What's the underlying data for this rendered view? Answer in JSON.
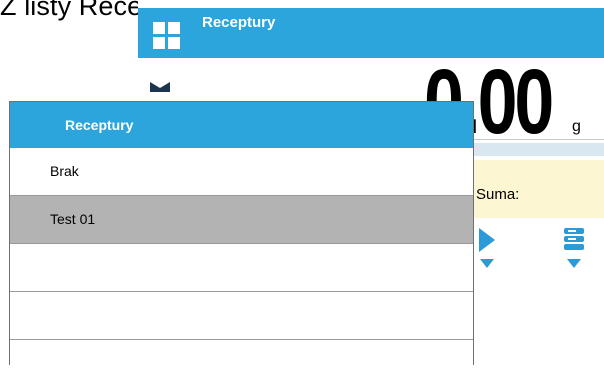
{
  "caption": "Z listy Receptur wybrać tę, która ma być z",
  "scale": {
    "title": "Receptury",
    "weight_value": "0.00",
    "unit": "g",
    "suma_label": "Suma:",
    "accent_color": "#2ca5dc",
    "icons": [
      "grid-icon",
      "tare-icon",
      "play-icon",
      "stack-icon"
    ]
  },
  "list": {
    "title": "Receptury",
    "items": [
      {
        "label": "Brak",
        "selected": false
      },
      {
        "label": "Test 01",
        "selected": true
      },
      {
        "label": "",
        "selected": false
      },
      {
        "label": "",
        "selected": false
      },
      {
        "label": "",
        "selected": false
      }
    ],
    "selected_color": "#b3b3b3"
  }
}
